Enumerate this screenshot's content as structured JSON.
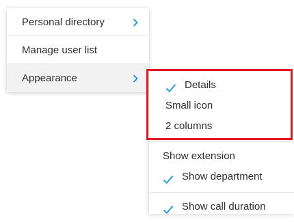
{
  "menu": {
    "items": [
      {
        "label": "Personal directory",
        "has_submenu": true
      },
      {
        "label": "Manage user list",
        "has_submenu": false
      },
      {
        "label": "Appearance",
        "has_submenu": true
      }
    ]
  },
  "submenu": {
    "items": [
      {
        "label": "Details",
        "checked": true
      },
      {
        "label": "Small icon",
        "checked": false
      },
      {
        "label": "2 columns",
        "checked": false
      },
      {
        "label": "Show extension",
        "checked": false
      },
      {
        "label": "Show department",
        "checked": true
      },
      {
        "label": "Show call duration",
        "checked": true
      }
    ]
  },
  "colors": {
    "accent": "#2a9fd8",
    "highlight": "#e01b24",
    "divider": "#e3e3e3"
  },
  "icons": {
    "submenu_arrow": "chevron-right-icon",
    "check": "checkmark-icon"
  }
}
